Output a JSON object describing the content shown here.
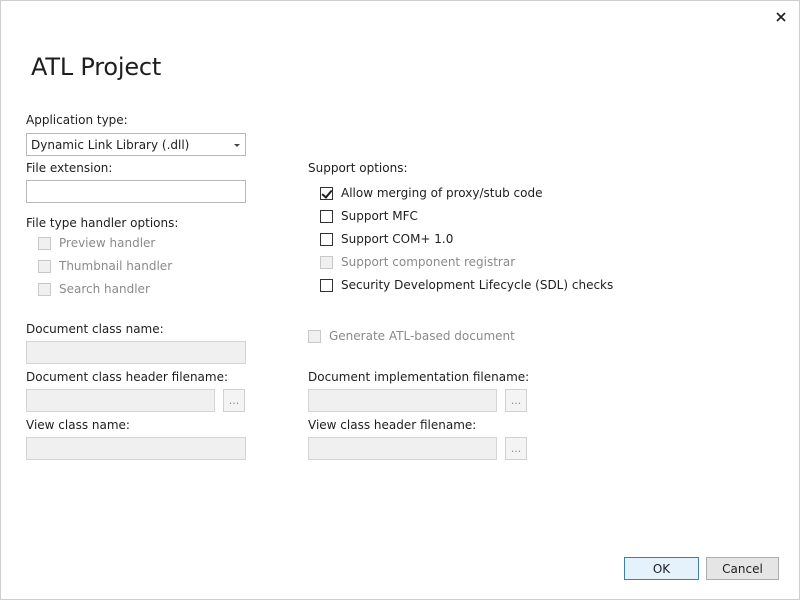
{
  "dialog": {
    "title": "ATL Project",
    "close_icon": "close-icon"
  },
  "application_type": {
    "label": "Application type:",
    "selected": "Dynamic Link Library (.dll)"
  },
  "file_extension": {
    "label": "File extension:",
    "value": ""
  },
  "file_type_handler": {
    "label": "File type handler options:",
    "options": [
      {
        "label": "Preview handler",
        "checked": false,
        "enabled": false
      },
      {
        "label": "Thumbnail handler",
        "checked": false,
        "enabled": false
      },
      {
        "label": "Search handler",
        "checked": false,
        "enabled": false
      }
    ]
  },
  "support_options": {
    "label": "Support options:",
    "options": [
      {
        "label": "Allow merging of proxy/stub code",
        "checked": true,
        "enabled": true
      },
      {
        "label": "Support MFC",
        "checked": false,
        "enabled": true
      },
      {
        "label": "Support COM+ 1.0",
        "checked": false,
        "enabled": true
      },
      {
        "label": "Support component registrar",
        "checked": false,
        "enabled": false
      },
      {
        "label": "Security Development Lifecycle (SDL) checks",
        "checked": false,
        "enabled": true
      }
    ]
  },
  "document": {
    "class_name_label": "Document class name:",
    "header_filename_label": "Document class header filename:",
    "generate_label": "Generate ATL-based document",
    "implementation_filename_label": "Document implementation filename:"
  },
  "view": {
    "class_name_label": "View class name:",
    "header_filename_label": "View class header filename:"
  },
  "browse_label": "...",
  "buttons": {
    "ok": "OK",
    "cancel": "Cancel"
  }
}
